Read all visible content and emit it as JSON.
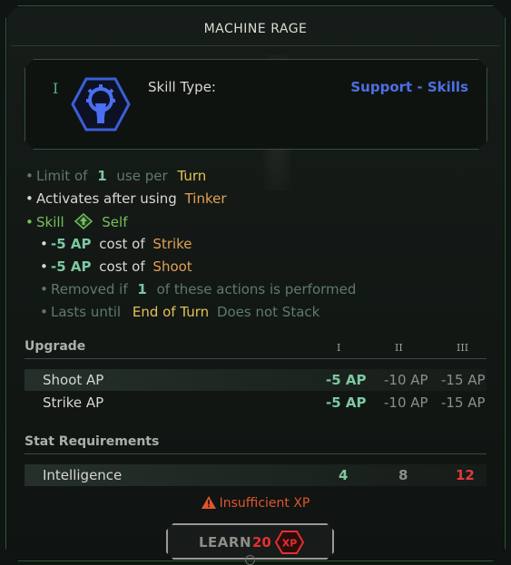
{
  "title": "MACHINE RAGE",
  "skill": {
    "tier_mark": "I",
    "icon": "gear-fist-icon",
    "type_label": "Skill Type:",
    "type_value": "Support - Skills"
  },
  "effects": {
    "limit": {
      "pre": "Limit of",
      "count": "1",
      "mid": "use per",
      "unit": "Turn"
    },
    "activates": {
      "pre": "Activates after using",
      "target": "Tinker"
    },
    "skill": {
      "pre": "Skill",
      "icon": "self-arrow-icon",
      "target": "Self"
    },
    "ap_strike": {
      "amount": "-5 AP",
      "mid": "cost of",
      "target": "Strike"
    },
    "ap_shoot": {
      "amount": "-5 AP",
      "mid": "cost of",
      "target": "Shoot"
    },
    "removed": {
      "pre": "Removed if",
      "count": "1",
      "post": "of these actions is performed"
    },
    "lasts": {
      "pre": "Lasts until",
      "target": "End of Turn",
      "post": "Does not Stack"
    }
  },
  "upgrade": {
    "heading": "Upgrade",
    "tiers": [
      "I",
      "II",
      "III"
    ],
    "rows": [
      {
        "label": "Shoot AP",
        "values": [
          "-5 AP",
          "-10 AP",
          "-15 AP"
        ]
      },
      {
        "label": "Strike AP",
        "values": [
          "-5 AP",
          "-10 AP",
          "-15 AP"
        ]
      }
    ]
  },
  "requirements": {
    "heading": "Stat Requirements",
    "rows": [
      {
        "label": "Intelligence",
        "values": [
          "4",
          "8",
          "12"
        ]
      }
    ]
  },
  "warning": {
    "icon": "warning-icon",
    "text": "Insufficient XP"
  },
  "learn": {
    "label": "LEARN",
    "cost": "20",
    "badge": "XP"
  },
  "colors": {
    "accent_green": "#78c05a",
    "gold": "#e3c257",
    "orange": "#e2a055",
    "blue": "#4d6fe0",
    "red": "#e23a3a"
  }
}
